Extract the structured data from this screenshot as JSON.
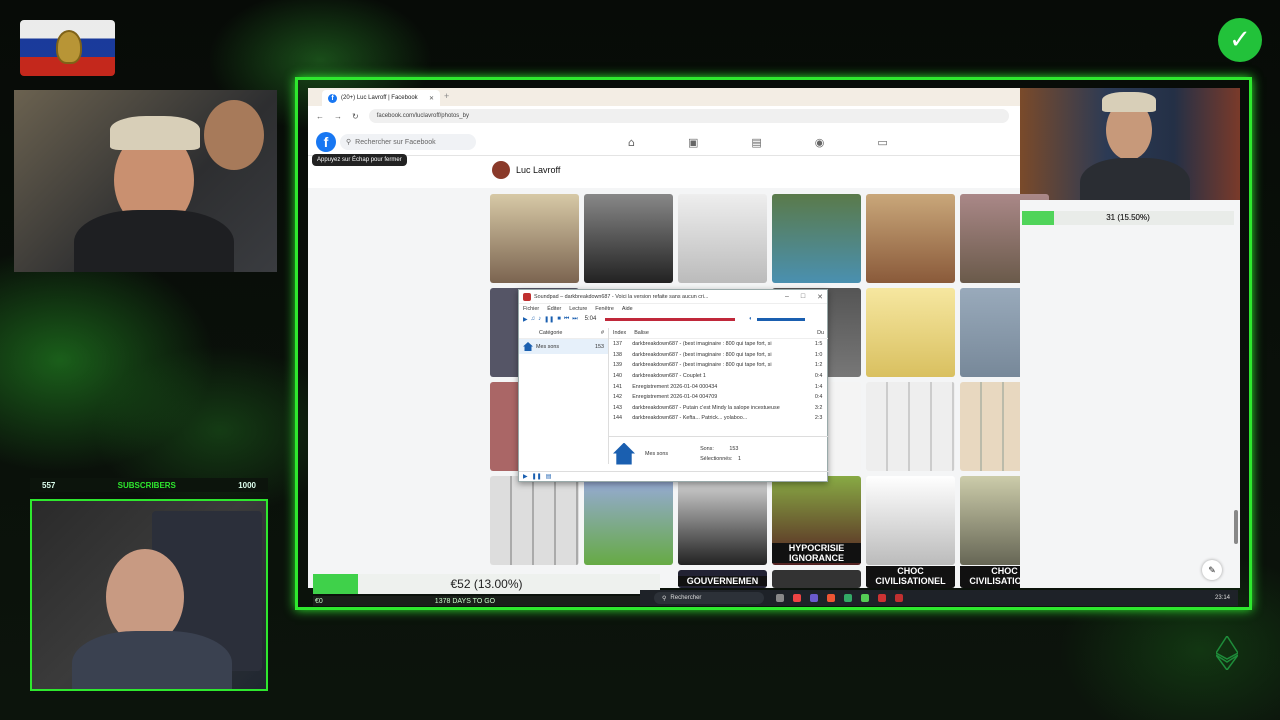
{
  "overlay": {
    "subscribers_current": "557",
    "subscribers_label": "SUBSCRIBERS",
    "subscribers_goal": "1000",
    "goal_progress_text": "31 (15.50%)",
    "donation_text": "€52 (13.00%)",
    "donation_progress": 0.13,
    "bottom_left_text": "€0",
    "countdown_text": "1378 DAYS TO GO",
    "accent_color": "#2ee82e"
  },
  "browser": {
    "tab_title": "(20+) Luc Lavroff | Facebook",
    "url": "facebook.com/luclavroff/photos_by",
    "search_placeholder": "Rechercher sur Facebook",
    "tooltip": "Appuyez sur Échap pour fermer",
    "profile_name": "Luc Lavroff",
    "grid_captions": [
      "CHOC CIVILISATIONEL",
      "CHOC CIVILISATIONEL",
      "GOUVERNEMEN",
      "HYPOCRISIE IGNORANCE"
    ]
  },
  "soundpad": {
    "title": "Soundpad – darkbreakdown687 - Voici la version refaite sans aucun cri...",
    "menu": [
      "Fichier",
      "Éditer",
      "Lecture",
      "Fenêtre",
      "Aide"
    ],
    "time": "5:04",
    "col_category": "Catégorie",
    "col_hash": "#",
    "col_index": "Index",
    "col_tag": "Balise",
    "col_duration": "Du",
    "category_name": "Mes sons",
    "category_count": "153",
    "rows": [
      {
        "index": "137",
        "name": "darkbreakdown687 - (best imaginaire : 800 qui tape fort, si",
        "dur": "1:5"
      },
      {
        "index": "138",
        "name": "darkbreakdown687 - (best imaginaire : 800 qui tape fort, si",
        "dur": "1:0"
      },
      {
        "index": "139",
        "name": "darkbreakdown687 - (best imaginaire : 800 qui tape fort, si",
        "dur": "1:2"
      },
      {
        "index": "140",
        "name": "darkbreakdown687 - Couplet 1",
        "dur": "0:4"
      },
      {
        "index": "141",
        "name": "Enregistrement 2026-01-04 000434",
        "dur": "1:4"
      },
      {
        "index": "142",
        "name": "Enregistrement 2026-01-04 004709",
        "dur": "0:4"
      },
      {
        "index": "143",
        "name": "darkbreakdown687 - Putain c'est Mindy la salope incestueuse",
        "dur": "3:2"
      },
      {
        "index": "144",
        "name": "darkbreakdown687 - Kefta... Patrick... yolaboo...",
        "dur": "2:3"
      }
    ],
    "info_name": "Mes sons",
    "info_sounds_label": "Sons:",
    "info_sounds_value": "153",
    "info_selected_label": "Sélectionnés:",
    "info_selected_value": "1"
  },
  "taskbar": {
    "search_label": "Rechercher",
    "time": "23:14"
  }
}
